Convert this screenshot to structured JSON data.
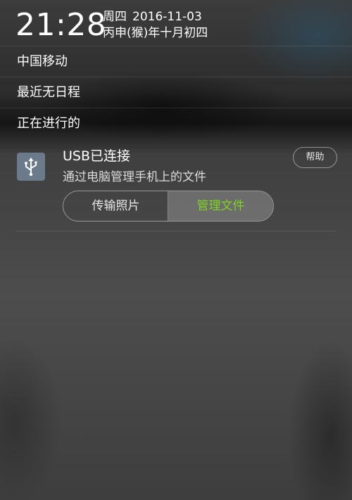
{
  "colors": {
    "accent_green": "#7ed321",
    "usb_icon_bg": "#6b7b8b"
  },
  "header": {
    "time": "21:28",
    "weekday": "周四",
    "date": "2016-11-03",
    "lunar_date": "丙申(猴)年十月初四"
  },
  "rows": {
    "carrier": "中国移动",
    "schedule": "最近无日程",
    "ongoing": "正在进行的"
  },
  "notification": {
    "icon": "usb-icon",
    "title": "USB已连接",
    "description": "通过电脑管理手机上的文件",
    "help_label": "帮助",
    "options": {
      "transfer_photos": "传输照片",
      "manage_files": "管理文件",
      "selected": "管理文件"
    }
  }
}
